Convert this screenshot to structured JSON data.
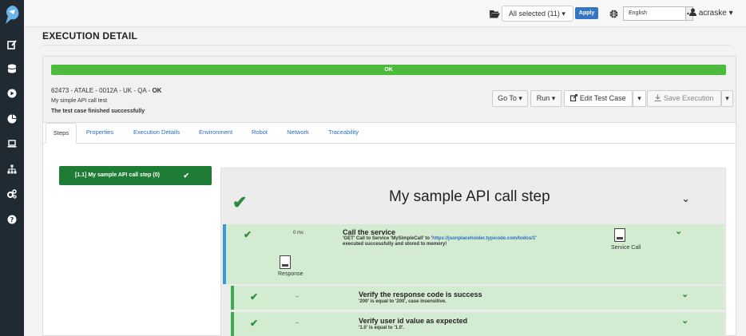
{
  "sidebar": {
    "icons": [
      "logo-icon",
      "edit-icon",
      "database-icon",
      "play-icon",
      "chart-icon",
      "laptop-icon",
      "sitemap-icon",
      "cogs-icon",
      "help-icon"
    ]
  },
  "topbar": {
    "selection": "All selected (11) ▾",
    "apply": "Apply",
    "language": "English",
    "user": "acraske ▾"
  },
  "page": {
    "title": "EXECUTION DETAIL"
  },
  "execution": {
    "status_bar": "OK",
    "ref": "62473 - ATALE - 0012A - UK - QA - ",
    "ref_status": "OK",
    "description": "My simple API call test",
    "result_message": "The test case finished successfully"
  },
  "actions": {
    "goto": "Go To ▾",
    "run": "Run ▾",
    "edit": "Edit Test Case",
    "caret": "▾",
    "save": "Save Execution"
  },
  "tabs": [
    "Steps",
    "Properties",
    "Execution Details",
    "Environment",
    "Robot",
    "Network",
    "Traceability"
  ],
  "steps": {
    "list_item": "[1.1] My sample API call step (0)",
    "check": "✔",
    "title": "My sample API call step",
    "chevron": "⌄"
  },
  "action": {
    "check": "✔",
    "time": "0 ms",
    "title": "Call the service",
    "msg_part1": "'GET' Call to Service 'MySimpleCall' to '",
    "msg_link": "https://jsonplaceholder.typicode.com/todos/1",
    "msg_part2": "'",
    "msg_line2": "executed successfully and stored to memory!",
    "file1_label": "Service Call",
    "file2_label": "Response",
    "chevron": "⌄"
  },
  "controls": [
    {
      "check": "✔",
      "time": "--",
      "title": "Verify the response code is success",
      "msg": "'200' is equal to '200', case insensitive.",
      "chevron": "⌄"
    },
    {
      "check": "✔",
      "time": "--",
      "title": "Verify user id value as expected",
      "msg": "'1.0' is equal to '1.0'.",
      "chevron": "⌄"
    }
  ],
  "colors": {
    "sidebar": "#1f2a33",
    "ok": "#4cbb3c",
    "step_item": "#1f7c35",
    "action_bg": "#d3ecd1",
    "action_border": "#3a9ad9",
    "control_border": "#3aae4a",
    "link": "#2a6cc0"
  }
}
